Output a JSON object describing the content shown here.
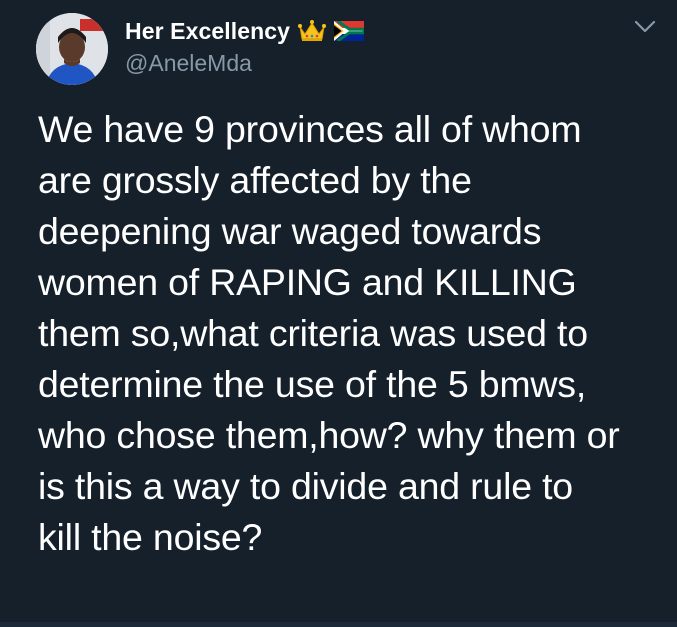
{
  "tweet": {
    "author": {
      "display_name": "Her Excellency",
      "handle": "@AneleMda",
      "name_emojis": [
        "crown-icon",
        "south-africa-flag-icon"
      ]
    },
    "text": "We have 9 provinces all of whom\nare grossly affected by the\ndeepening war waged towards\nwomen of RAPING and KILLING\nthem so,what criteria was used to\ndetermine the use of the 5 bmws,\nwho chose them,how? why them or\nis this a way to divide and rule to\nkill the noise?",
    "menu_icon": "chevron-down-icon"
  },
  "colors": {
    "background": "#15202b",
    "text": "#ffffff",
    "secondary_text": "#8899a6"
  }
}
